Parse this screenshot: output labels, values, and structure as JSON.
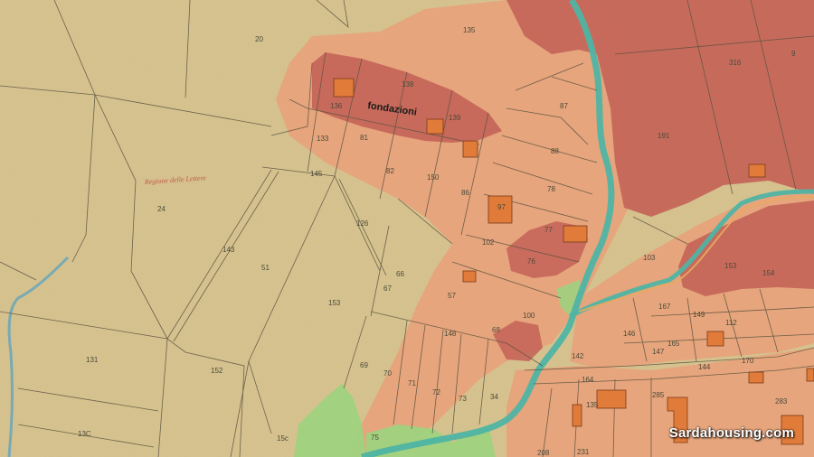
{
  "map": {
    "annotation": "fondazioni",
    "area_label": "Regione delle Lettere",
    "watermark": "Sardahousing.com",
    "colors": {
      "base": "#d8c48f",
      "zone_light": "#e8a27a",
      "zone_dark": "#c5665a",
      "river": "#4fb4a4",
      "green": "#9fd27f",
      "building": "#e07b3a"
    },
    "parcels": [
      {
        "id": "p20",
        "label": "20"
      },
      {
        "id": "p135",
        "label": "135"
      },
      {
        "id": "p136",
        "label": "136"
      },
      {
        "id": "p138",
        "label": "138"
      },
      {
        "id": "p139",
        "label": "139"
      },
      {
        "id": "p133",
        "label": "133"
      },
      {
        "id": "p81",
        "label": "81"
      },
      {
        "id": "p82",
        "label": "82"
      },
      {
        "id": "p145",
        "label": "145"
      },
      {
        "id": "p24",
        "label": "24"
      },
      {
        "id": "p143",
        "label": "143"
      },
      {
        "id": "p51",
        "label": "51"
      },
      {
        "id": "p153a",
        "label": "153"
      },
      {
        "id": "p131",
        "label": "131"
      },
      {
        "id": "p152",
        "label": "152"
      },
      {
        "id": "p130",
        "label": "13C"
      },
      {
        "id": "p150",
        "label": "15c"
      },
      {
        "id": "p126",
        "label": "126"
      },
      {
        "id": "p66",
        "label": "66"
      },
      {
        "id": "p67",
        "label": "67"
      },
      {
        "id": "p69",
        "label": "69"
      },
      {
        "id": "p70",
        "label": "70"
      },
      {
        "id": "p150b",
        "label": "150"
      },
      {
        "id": "p86",
        "label": "86"
      },
      {
        "id": "p87",
        "label": "87"
      },
      {
        "id": "p88",
        "label": "88"
      },
      {
        "id": "p78",
        "label": "78"
      },
      {
        "id": "p97",
        "label": "97"
      },
      {
        "id": "p77",
        "label": "77"
      },
      {
        "id": "p102",
        "label": "102"
      },
      {
        "id": "p76",
        "label": "76"
      },
      {
        "id": "p57",
        "label": "57"
      },
      {
        "id": "p100",
        "label": "100"
      },
      {
        "id": "p148",
        "label": "148"
      },
      {
        "id": "p68",
        "label": "68"
      },
      {
        "id": "p71",
        "label": "71"
      },
      {
        "id": "p72",
        "label": "72"
      },
      {
        "id": "p73",
        "label": "73"
      },
      {
        "id": "p34",
        "label": "34"
      },
      {
        "id": "p75",
        "label": "75"
      },
      {
        "id": "p316",
        "label": "316"
      },
      {
        "id": "p9",
        "label": "9"
      },
      {
        "id": "p191",
        "label": "191"
      },
      {
        "id": "p103",
        "label": "103"
      },
      {
        "id": "p153b",
        "label": "153"
      },
      {
        "id": "p154",
        "label": "154"
      },
      {
        "id": "p167",
        "label": "167"
      },
      {
        "id": "p149",
        "label": "149"
      },
      {
        "id": "p142",
        "label": "142"
      },
      {
        "id": "p146",
        "label": "146"
      },
      {
        "id": "p147",
        "label": "147"
      },
      {
        "id": "p165",
        "label": "165"
      },
      {
        "id": "p112",
        "label": "112"
      },
      {
        "id": "p144",
        "label": "144"
      },
      {
        "id": "p170",
        "label": "170"
      },
      {
        "id": "p164",
        "label": "164"
      },
      {
        "id": "p135b",
        "label": "135"
      },
      {
        "id": "p285",
        "label": "285"
      },
      {
        "id": "p283",
        "label": "283"
      },
      {
        "id": "p208",
        "label": "208"
      },
      {
        "id": "p231",
        "label": "231"
      }
    ]
  }
}
